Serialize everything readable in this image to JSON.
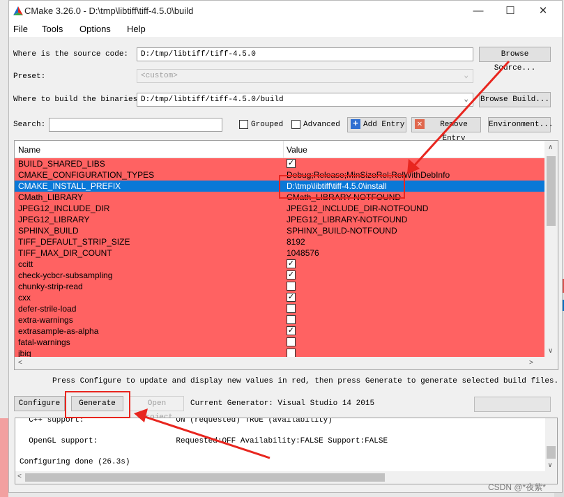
{
  "window": {
    "title": "CMake 3.26.0 - D:\\tmp\\libtiff\\tiff-4.5.0\\build",
    "minimize": "—",
    "maximize": "☐",
    "close": "✕"
  },
  "menu": [
    "File",
    "Tools",
    "Options",
    "Help"
  ],
  "source": {
    "label": "Where is the source code:",
    "value": "D:/tmp/libtiff/tiff-4.5.0",
    "button": "Browse Source..."
  },
  "preset": {
    "label": "Preset:",
    "value": "<custom>"
  },
  "build": {
    "label": "Where to build the binaries:",
    "value": "D:/tmp/libtiff/tiff-4.5.0/build",
    "button": "Browse Build..."
  },
  "search": {
    "label": "Search:",
    "value": "",
    "grouped": "Grouped",
    "advanced": "Advanced",
    "add_entry": "Add Entry",
    "remove_entry": "Remove Entry",
    "environment": "Environment..."
  },
  "table": {
    "headers": [
      "Name",
      "Value"
    ],
    "rows": [
      {
        "name": "BUILD_SHARED_LIBS",
        "type": "bool",
        "checked": true
      },
      {
        "name": "CMAKE_CONFIGURATION_TYPES",
        "type": "text",
        "value": "Debug;Release;MinSizeRel;RelWithDebInfo"
      },
      {
        "name": "CMAKE_INSTALL_PREFIX",
        "type": "text",
        "value": "D:\\tmp\\libtiff\\tiff-4.5.0\\install",
        "selected": true
      },
      {
        "name": "CMath_LIBRARY",
        "type": "text",
        "value": "CMath_LIBRARY-NOTFOUND"
      },
      {
        "name": "JPEG12_INCLUDE_DIR",
        "type": "text",
        "value": "JPEG12_INCLUDE_DIR-NOTFOUND"
      },
      {
        "name": "JPEG12_LIBRARY",
        "type": "text",
        "value": "JPEG12_LIBRARY-NOTFOUND"
      },
      {
        "name": "SPHINX_BUILD",
        "type": "text",
        "value": "SPHINX_BUILD-NOTFOUND"
      },
      {
        "name": "TIFF_DEFAULT_STRIP_SIZE",
        "type": "text",
        "value": "8192"
      },
      {
        "name": "TIFF_MAX_DIR_COUNT",
        "type": "text",
        "value": "1048576"
      },
      {
        "name": "ccitt",
        "type": "bool",
        "checked": true
      },
      {
        "name": "check-ycbcr-subsampling",
        "type": "bool",
        "checked": true
      },
      {
        "name": "chunky-strip-read",
        "type": "bool",
        "checked": false
      },
      {
        "name": "cxx",
        "type": "bool",
        "checked": true
      },
      {
        "name": "defer-strile-load",
        "type": "bool",
        "checked": false
      },
      {
        "name": "extra-warnings",
        "type": "bool",
        "checked": false
      },
      {
        "name": "extrasample-as-alpha",
        "type": "bool",
        "checked": true
      },
      {
        "name": "fatal-warnings",
        "type": "bool",
        "checked": false
      },
      {
        "name": "jbig",
        "type": "bool",
        "checked": false
      }
    ]
  },
  "hint": "Press Configure to update and display new values in red, then press Generate to generate selected build files.",
  "actions": {
    "configure": "Configure",
    "generate": "Generate",
    "open_project": "Open Project",
    "current_generator": "Current Generator: Visual Studio 14 2015"
  },
  "output": {
    "lines": [
      "  C++ support:                    ON (requested) TRUE (availability)",
      "",
      "  OpenGL support:                 Requested:OFF Availability:FALSE Support:FALSE",
      "",
      "Configuring done (26.3s)"
    ]
  },
  "watermark": "CSDN @*夜紫*",
  "colors": {
    "new_entry_bg": "#ff6262",
    "selection": "#0a78d7",
    "annotation": "#e8261f"
  }
}
